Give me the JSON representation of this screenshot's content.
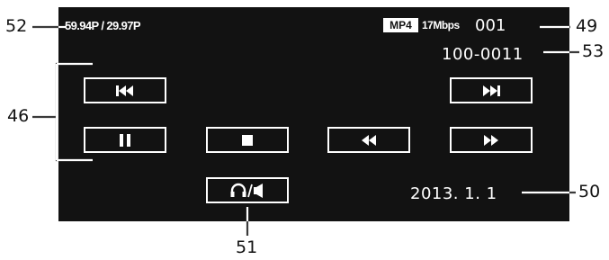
{
  "display": {
    "frame_rate": "59.94P / 29.97P",
    "format_badge": "MP4",
    "bitrate": "17Mbps",
    "clip_number": "001",
    "folder_file": "100-0011",
    "date": "2013.  1.  1"
  },
  "controls": {
    "skip_back": "skip-back-icon",
    "skip_forward": "skip-forward-icon",
    "pause": "pause-icon",
    "stop": "stop-icon",
    "rewind": "rewind-icon",
    "fast_forward": "fast-forward-icon",
    "audio": "headphones-speaker-icon"
  },
  "callouts": {
    "c46": "46",
    "c49": "49",
    "c50": "50",
    "c51": "51",
    "c52": "52",
    "c53": "53"
  },
  "colors": {
    "screen_bg": "#121212",
    "foreground": "#ffffff",
    "callout": "#121212"
  }
}
